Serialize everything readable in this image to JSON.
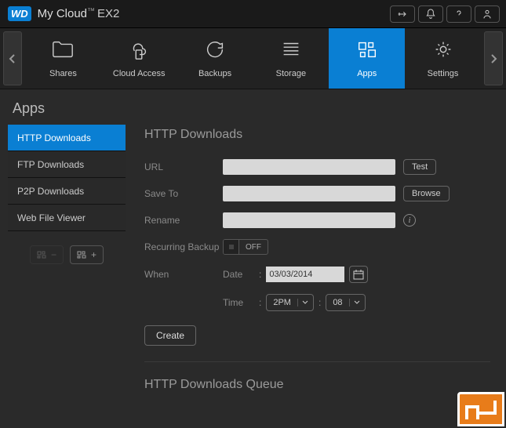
{
  "header": {
    "logo_text": "WD",
    "product": "My Cloud",
    "tm": "™",
    "model": "EX2"
  },
  "nav": {
    "items": [
      {
        "label": "Shares"
      },
      {
        "label": "Cloud Access"
      },
      {
        "label": "Backups"
      },
      {
        "label": "Storage"
      },
      {
        "label": "Apps"
      },
      {
        "label": "Settings"
      }
    ]
  },
  "page_title": "Apps",
  "sidebar": {
    "items": [
      {
        "label": "HTTP Downloads"
      },
      {
        "label": "FTP Downloads"
      },
      {
        "label": "P2P Downloads"
      },
      {
        "label": "Web File Viewer"
      }
    ]
  },
  "main": {
    "title": "HTTP Downloads",
    "url_label": "URL",
    "save_to_label": "Save To",
    "rename_label": "Rename",
    "recurring_label": "Recurring Backup",
    "toggle_off": "OFF",
    "when_label": "When",
    "date_label": "Date",
    "date_value": "03/03/2014",
    "time_label": "Time",
    "time_hour": "2PM",
    "time_min": "08",
    "test_btn": "Test",
    "browse_btn": "Browse",
    "create_btn": "Create",
    "queue_title": "HTTP Downloads Queue",
    "url_value": "",
    "save_to_value": "",
    "rename_value": ""
  }
}
